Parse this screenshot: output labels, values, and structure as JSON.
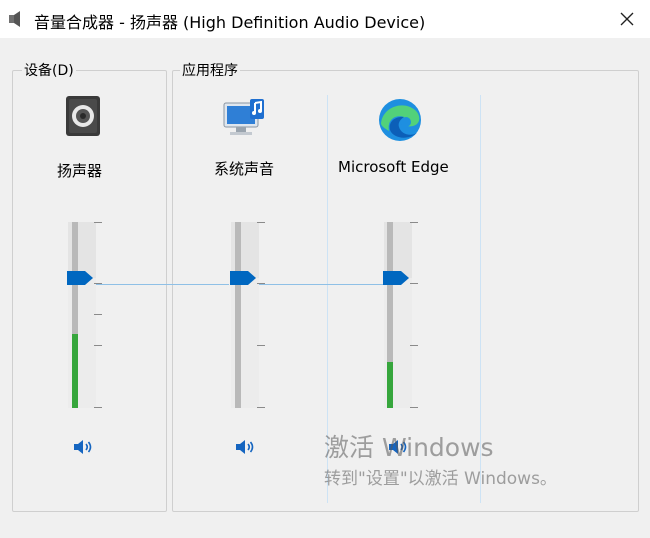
{
  "window": {
    "title": "音量合成器 - 扬声器 (High Definition Audio Device)",
    "close_glyph": "✕"
  },
  "groups": {
    "devices_label": "设备(D)",
    "apps_label": "应用程序"
  },
  "columns": [
    {
      "name": "扬声器",
      "icon": "speaker-device-icon",
      "volume_percent": 70,
      "meter_percent": 40
    },
    {
      "name": "系统声音",
      "icon": "system-sounds-icon",
      "volume_percent": 70,
      "meter_percent": 0
    },
    {
      "name": "Microsoft Edge",
      "icon": "edge-browser-icon",
      "volume_percent": 70,
      "meter_percent": 25
    }
  ],
  "watermark": {
    "title": "激活 Windows",
    "subtitle": "转到\"设置\"以激活 Windows。"
  },
  "colors": {
    "accent": "#0067c0",
    "meter_green": "#36a63c"
  }
}
